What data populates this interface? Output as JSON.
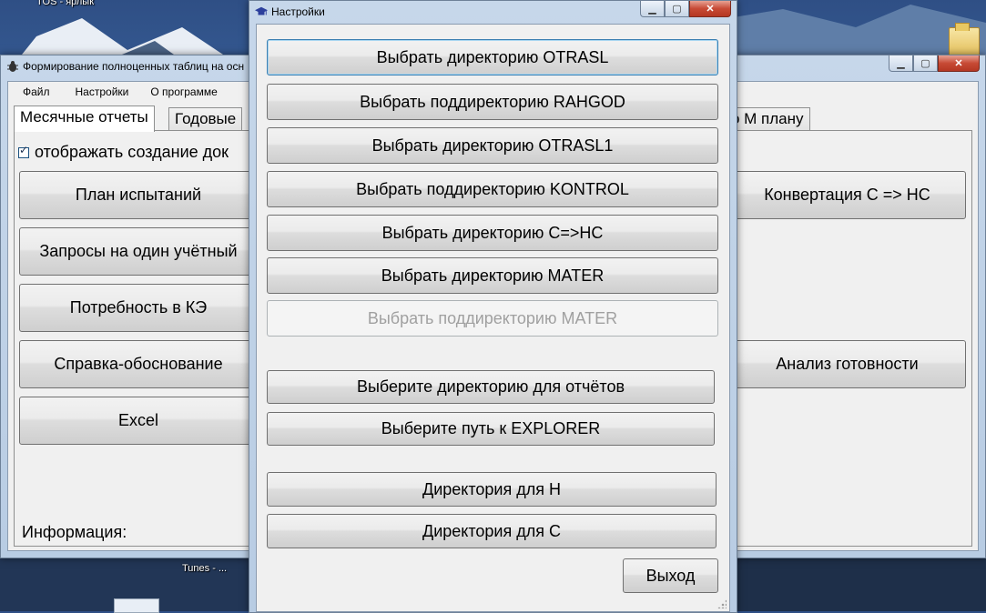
{
  "desktop": {
    "top_label": "TOS - ярлык",
    "taskbar_label_1": "Tunes - ...",
    "taskbar_label_2": "...",
    "icons": [
      "folder-icon"
    ]
  },
  "main_window": {
    "title": "Формирование полноценных таблиц на осн",
    "icon": "bug-icon",
    "menu": [
      "Файл",
      "Настройки",
      "О программе"
    ],
    "tabs": [
      "Месячные отчеты",
      "Годовые",
      "о М плану"
    ],
    "checkbox_label": "отображать создание док",
    "checkbox_checked": true,
    "left_buttons": [
      "План испытаний",
      "Запросы на один учётный",
      "Потребность в КЭ",
      "Справка-обоснование",
      "Excel"
    ],
    "right_buttons": [
      "Конвертация С => НС",
      "Анализ готовности"
    ],
    "info_label": "Информация:"
  },
  "settings_dialog": {
    "title": "Настройки",
    "icon": "graduation-cap-icon",
    "buttons": [
      {
        "label": "Выбрать директорию OTRASL",
        "state": "focused"
      },
      {
        "label": "Выбрать поддиректорию RAHGOD",
        "state": "normal"
      },
      {
        "label": "Выбрать директорию OTRASL1",
        "state": "normal"
      },
      {
        "label": "Выбрать поддиректорию KONTROL",
        "state": "normal"
      },
      {
        "label": "Выбрать директорию C=>HC",
        "state": "normal"
      },
      {
        "label": "Выбрать директорию MATER",
        "state": "normal"
      },
      {
        "label": "Выбрать поддиректорию MATER",
        "state": "disabled"
      },
      {
        "label": "Выберите директорию для отчётов",
        "state": "normal"
      },
      {
        "label": "Выберите путь к EXPLORER",
        "state": "normal"
      },
      {
        "label": "Директория для Н",
        "state": "normal"
      },
      {
        "label": "Директория для С",
        "state": "normal"
      }
    ],
    "exit_label": "Выход"
  },
  "colors": {
    "window_frame": "#b8cce3",
    "client_bg": "#f0f0f0",
    "close_button": "#c74a35",
    "focus_border": "#3c7fb1",
    "disabled_text": "#a0a0a0"
  }
}
